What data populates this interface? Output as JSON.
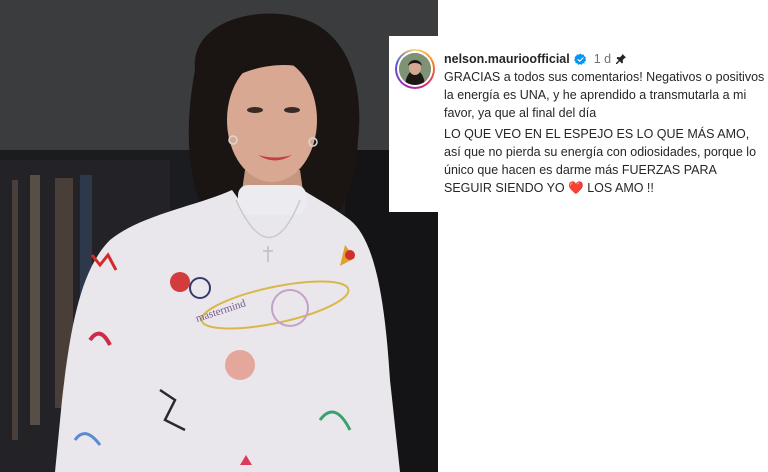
{
  "comment": {
    "username": "nelson.maurioofficial",
    "time": "1 d",
    "verified_icon": "verified-badge-icon",
    "pin_icon": "pin-icon",
    "paragraph1": "GRACIAS a todos sus comentarios! Negativos o positivos la energía es UNA, y he aprendido a transmutarla a mi favor, ya que al final del día",
    "paragraph2_before": "LO QUE VEO EN EL ESPEJO ES LO QUE MÁS AMO, así que no pierda su energía con odiosidades, porque lo único que hacen es darme más FUERZAS PARA SEGUIR SIENDO YO",
    "heart_emoji": "❤️",
    "paragraph2_after": "LOS AMO !!"
  },
  "photo": {
    "shirt_text": "mastermind"
  },
  "colors": {
    "verified_blue": "#0095f6",
    "heart_red": "#e0245e",
    "text": "#262626",
    "muted": "#737373"
  }
}
